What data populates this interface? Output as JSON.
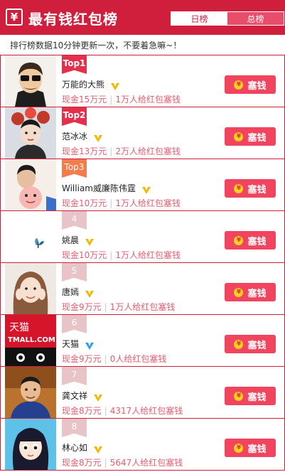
{
  "header": {
    "logo_glyph": "¥",
    "title": "最有钱红包榜",
    "tabs": [
      {
        "label": "日榜",
        "selected": true
      },
      {
        "label": "总榜",
        "selected": false
      }
    ]
  },
  "notice": "排行榜数据10分钟更新一次，不要着急嘛~！",
  "button_label": "塞钱",
  "rows": [
    {
      "rank": "Top1",
      "name": "万能的大熊",
      "verified": "gold",
      "cash": "现金15万元",
      "count": "1万人给红包塞钱",
      "avatar": "avatar-dabear"
    },
    {
      "rank": "Top2",
      "name": "范冰冰",
      "verified": "gold",
      "cash": "现金13万元",
      "count": "2万人给红包塞钱",
      "avatar": "avatar-fanbingbing"
    },
    {
      "rank": "Top3",
      "name": "William威廉陈伟霆",
      "verified": "gold",
      "cash": "现金10万元",
      "count": "1万人给红包塞钱",
      "avatar": "avatar-william"
    },
    {
      "rank": "4",
      "name": "姚晨",
      "verified": "gold",
      "cash": "现金10万元",
      "count": "1万人给红包塞钱",
      "avatar": "avatar-yaochen"
    },
    {
      "rank": "5",
      "name": "唐嫣",
      "verified": "gold",
      "cash": "现金9万元",
      "count": "1万人给红包塞钱",
      "avatar": "avatar-tangyan"
    },
    {
      "rank": "6",
      "name": "天猫",
      "verified": "blue",
      "cash": "现金9万元",
      "count": "0人给红包塞钱",
      "avatar": "avatar-tmall"
    },
    {
      "rank": "7",
      "name": "龚文祥",
      "verified": "gold",
      "cash": "现金8万元",
      "count": "4317人给红包塞钱",
      "avatar": "avatar-gongwenxiang"
    },
    {
      "rank": "8",
      "name": "林心如",
      "verified": "gold",
      "cash": "现金8万元",
      "count": "5647人给红包塞钱",
      "avatar": "avatar-linxinru"
    }
  ],
  "tmall_logo_text": {
    "line1": "天猫",
    "line2": "TMALL.COM"
  },
  "colors": {
    "brand": "#cf1f3c",
    "button": "#f1455f",
    "stat_text": "#e25d6f",
    "vip_gold": "#f2b700",
    "vip_blue": "#2a9df4"
  }
}
